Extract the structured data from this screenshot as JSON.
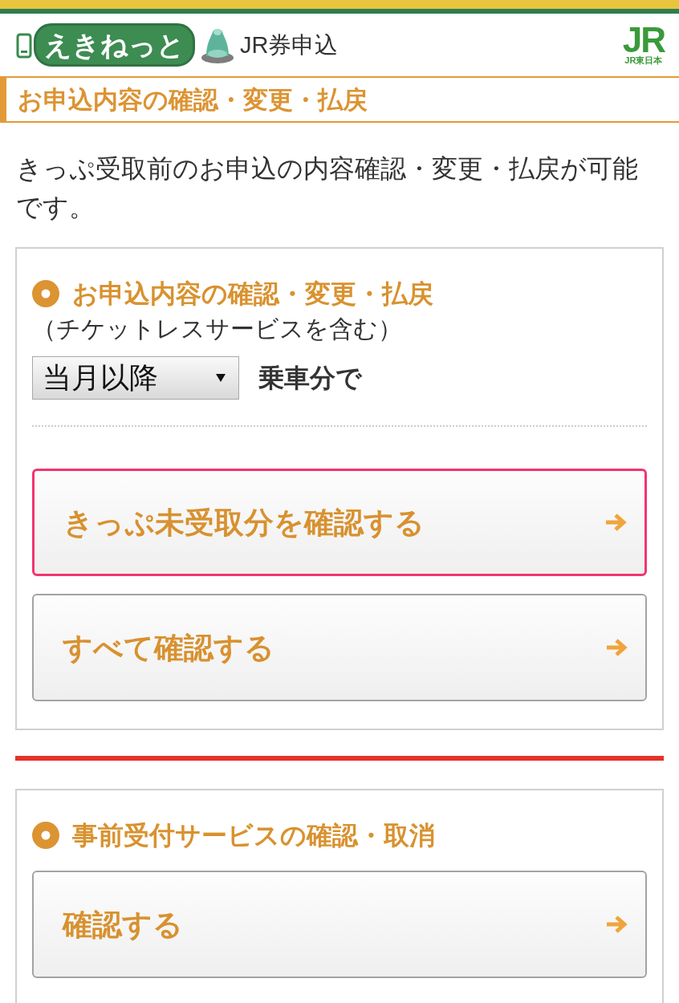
{
  "header": {
    "logo": {
      "wordmark": "えきねっと"
    },
    "title": "JR券申込",
    "brand_logo": {
      "mark": "JR",
      "caption": "JR東日本"
    }
  },
  "page_title": "お申込内容の確認・変更・払戻",
  "intro": "きっぷ受取前のお申込の内容確認・変更・払戻が可能です。",
  "sections": [
    {
      "heading": "お申込内容の確認・変更・払戻",
      "note": "（チケットレスサービスを含む）",
      "filter": {
        "select_value": "当月以降",
        "suffix": "乗車分で"
      },
      "buttons": [
        {
          "label": "きっぷ未受取分を確認する",
          "focused": true
        },
        {
          "label": "すべて確認する",
          "focused": false
        }
      ]
    },
    {
      "heading": "事前受付サービスの確認・取消",
      "buttons": [
        {
          "label": "確認する",
          "focused": false
        }
      ]
    }
  ]
}
